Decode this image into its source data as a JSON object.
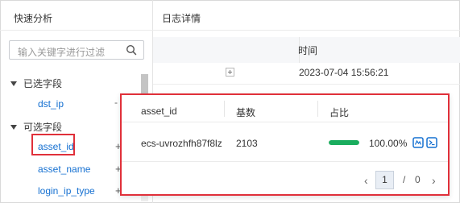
{
  "left_panel": {
    "title": "快速分析",
    "search_placeholder": "输入关键字进行过滤",
    "selected_group": "已选字段",
    "selected_fields": [
      "dst_ip"
    ],
    "available_group": "可选字段",
    "available_fields": [
      "asset_id",
      "asset_name",
      "login_ip_type"
    ],
    "selected_field_action": "-",
    "add_action": "+"
  },
  "right_panel": {
    "title": "日志详情",
    "time_header": "时间",
    "rows": [
      {
        "time": "2023-07-04 15:56:21"
      }
    ]
  },
  "popup": {
    "headers": [
      "asset_id",
      "基数",
      "占比"
    ],
    "rows": [
      {
        "value": "ecs-uvrozhfh87f8lz",
        "count": "2103",
        "ratio_text": "100.00%",
        "ratio": 1.0
      }
    ],
    "pagination": {
      "prev": "‹",
      "current": "1",
      "separator": "/",
      "total": "0",
      "next": "›"
    }
  },
  "colors": {
    "accent": "#1570d1",
    "highlight": "#e0303a",
    "progress": "#1aad5e"
  }
}
